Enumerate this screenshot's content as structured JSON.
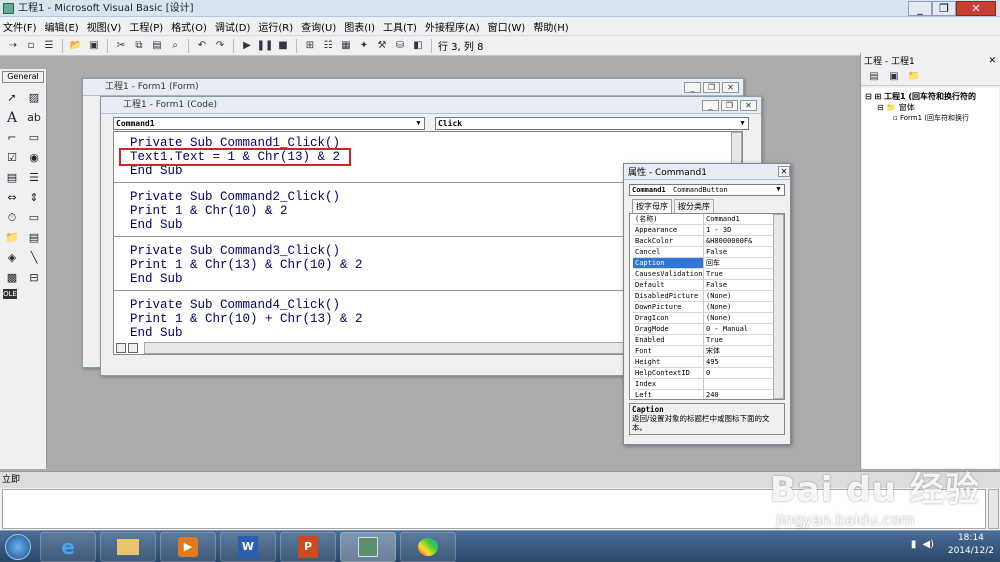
{
  "app": {
    "title": "工程1 - Microsoft Visual Basic [设计]"
  },
  "menu": [
    "文件(F)",
    "编辑(E)",
    "视图(V)",
    "工程(P)",
    "格式(O)",
    "调试(D)",
    "运行(R)",
    "查询(U)",
    "图表(I)",
    "工具(T)",
    "外接程序(A)",
    "窗口(W)",
    "帮助(H)"
  ],
  "toolbar": {
    "position": "行 3, 列 8"
  },
  "toolbox": {
    "title": "General"
  },
  "form_window": {
    "title": "工程1 - Form1 (Form)"
  },
  "code_window": {
    "title": "工程1 - Form1 (Code)",
    "object_combo": "Command1",
    "proc_combo": "Click",
    "blocks": [
      {
        "l1": "Private Sub Command1_Click()",
        "l2": "Text1.Text = 1 & Chr(13) & 2",
        "l3": "End Sub"
      },
      {
        "l1": "Private Sub Command2_Click()",
        "l2": "Print 1 & Chr(10) & 2",
        "l3": "End Sub"
      },
      {
        "l1": "Private Sub Command3_Click()",
        "l2": "Print 1 & Chr(13) & Chr(10) & 2",
        "l3": "End Sub"
      },
      {
        "l1": "Private Sub Command4_Click()",
        "l2": "Print 1 & Chr(10) + Chr(13) & 2",
        "l3": "End Sub"
      }
    ]
  },
  "properties": {
    "title": "属性 - Command1",
    "object": "Command1",
    "object_type": "CommandButton",
    "tab_alpha": "按字母序",
    "tab_cat": "按分类序",
    "rows": [
      {
        "name": "(名称)",
        "value": "Command1"
      },
      {
        "name": "Appearance",
        "value": "1 - 3D"
      },
      {
        "name": "BackColor",
        "value": "&H8000000F&"
      },
      {
        "name": "Cancel",
        "value": "False"
      },
      {
        "name": "Caption",
        "value": "回车"
      },
      {
        "name": "CausesValidation",
        "value": "True"
      },
      {
        "name": "Default",
        "value": "False"
      },
      {
        "name": "DisabledPicture",
        "value": "(None)"
      },
      {
        "name": "DownPicture",
        "value": "(None)"
      },
      {
        "name": "DragIcon",
        "value": "(None)"
      },
      {
        "name": "DragMode",
        "value": "0 - Manual"
      },
      {
        "name": "Enabled",
        "value": "True"
      },
      {
        "name": "Font",
        "value": "宋体"
      },
      {
        "name": "Height",
        "value": "495"
      },
      {
        "name": "HelpContextID",
        "value": "0"
      },
      {
        "name": "Index",
        "value": ""
      },
      {
        "name": "Left",
        "value": "240"
      }
    ],
    "desc_title": "Caption",
    "desc_text": "返回/设置对象的标题栏中或图标下面的文本。"
  },
  "project": {
    "title": "工程 - 工程1",
    "root": "工程1 (回车符和换行符的",
    "folder": "窗体",
    "form": "Form1 (回车符和换行"
  },
  "immediate": {
    "title": "立即"
  },
  "watermark": {
    "brand": "Bai du 经验",
    "url": "jingyan.baidu.com"
  },
  "clock": {
    "time": "18:14",
    "date": "2014/12/2"
  },
  "colors": {
    "highlight": "#d2232a",
    "code": "#000070",
    "selection": "#3177d6"
  }
}
